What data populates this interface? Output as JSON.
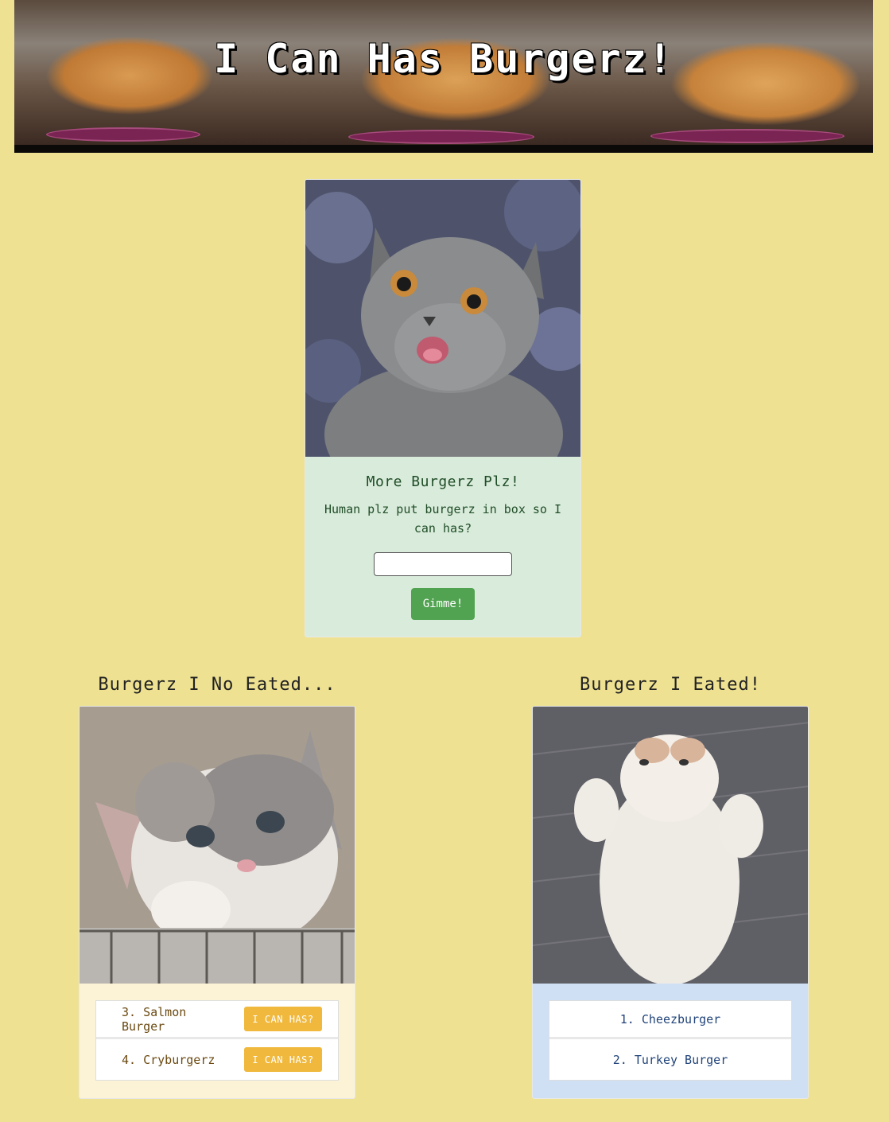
{
  "header": {
    "title": "I Can Has Burgerz!"
  },
  "form": {
    "heading": "More Burgerz Plz!",
    "text": "Human plz put burgerz in box so I can has?",
    "input_value": "",
    "button_label": "Gimme!"
  },
  "uneaten": {
    "heading": "Burgerz I No Eated...",
    "items": [
      {
        "label": "3. Salmon Burger",
        "button": "I CAN HAS?"
      },
      {
        "label": "4. Cryburgerz",
        "button": "I CAN HAS?"
      }
    ]
  },
  "eaten": {
    "heading": "Burgerz I Eated!",
    "items": [
      {
        "label": "1. Cheezburger"
      },
      {
        "label": "2. Turkey Burger"
      }
    ]
  },
  "colors": {
    "page_bg": "#eee191",
    "form_card_bg": "#d9ebdb",
    "uneaten_card_bg": "#fcf3d6",
    "eaten_card_bg": "#cfe0f5",
    "gimme_button": "#51a351",
    "can_has_button": "#f0b93d"
  }
}
